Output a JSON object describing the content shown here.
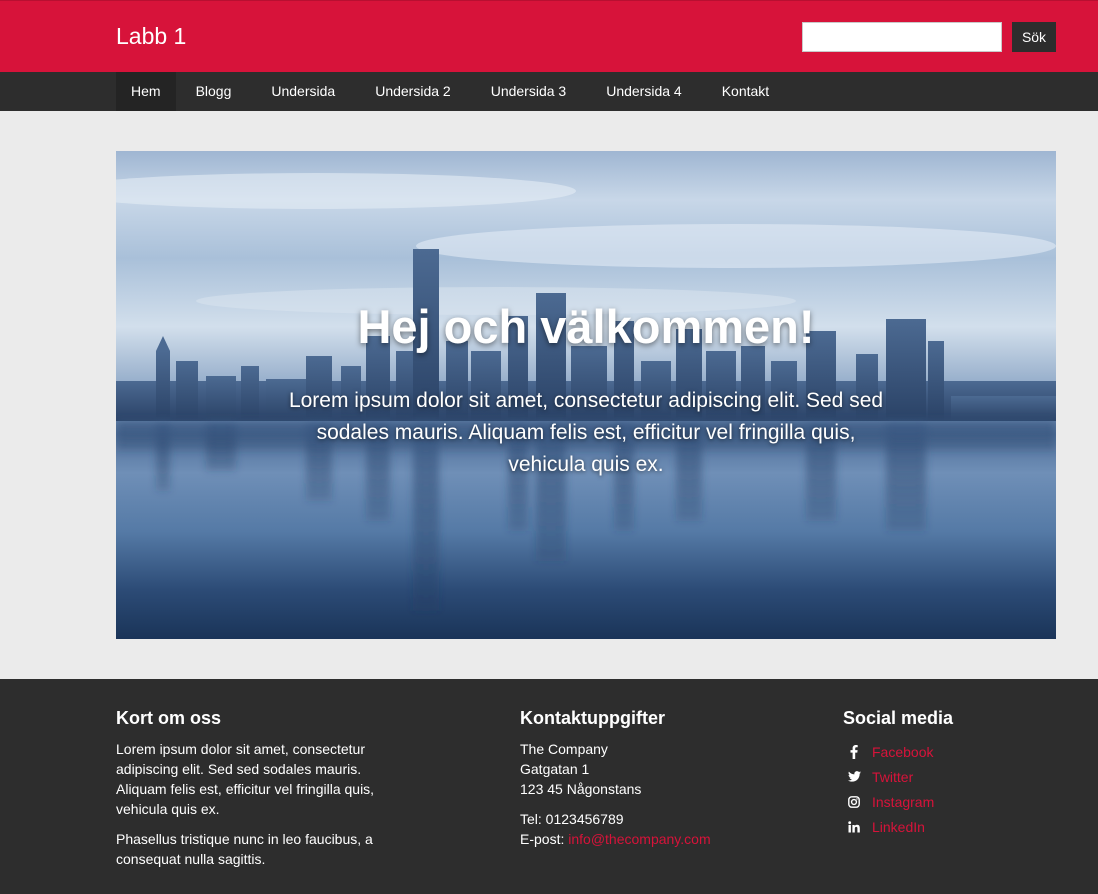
{
  "header": {
    "brand": "Labb 1",
    "search_placeholder": "",
    "search_value": "",
    "search_button": "Sök",
    "accent_color": "#d7133a"
  },
  "nav": {
    "items": [
      {
        "label": "Hem",
        "active": true
      },
      {
        "label": "Blogg"
      },
      {
        "label": "Undersida"
      },
      {
        "label": "Undersida 2"
      },
      {
        "label": "Undersida 3"
      },
      {
        "label": "Undersida 4"
      },
      {
        "label": "Kontakt"
      }
    ]
  },
  "hero": {
    "title": "Hej och välkommen!",
    "text": "Lorem ipsum dolor sit amet, consectetur adipiscing elit. Sed sed sodales mauris. Aliquam felis est, efficitur vel fringilla quis, vehicula quis ex."
  },
  "footer": {
    "about": {
      "heading": "Kort om oss",
      "p1": "Lorem ipsum dolor sit amet, consectetur adipiscing elit. Sed sed sodales mauris. Aliquam felis est, efficitur vel fringilla quis, vehicula quis ex.",
      "p2": "Phasellus tristique nunc in leo faucibus, a consequat nulla sagittis."
    },
    "contact": {
      "heading": "Kontaktuppgifter",
      "company": "The Company",
      "street": "Gatgatan 1",
      "city": "123 45 Någonstans",
      "tel": "Tel: 0123456789",
      "email_label": "E-post: ",
      "email": "info@thecompany.com"
    },
    "social": {
      "heading": "Social media",
      "items": [
        {
          "label": "Facebook",
          "icon": "facebook-icon"
        },
        {
          "label": "Twitter",
          "icon": "twitter-icon"
        },
        {
          "label": "Instagram",
          "icon": "instagram-icon"
        },
        {
          "label": "LinkedIn",
          "icon": "linkedin-icon"
        }
      ]
    }
  }
}
